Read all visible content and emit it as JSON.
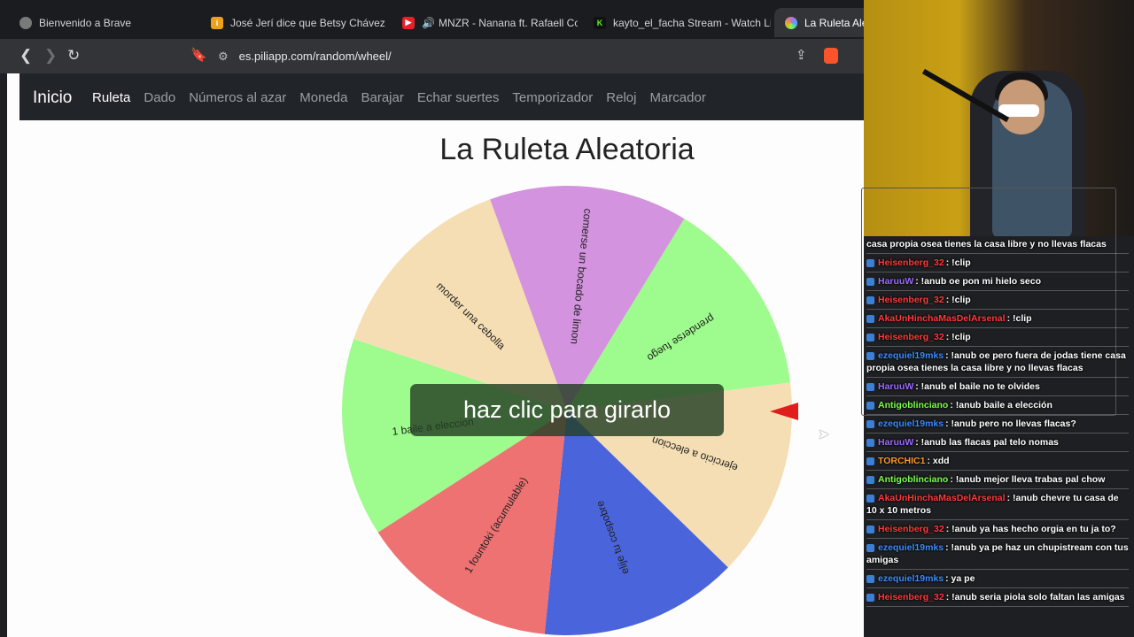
{
  "tabs": [
    {
      "title": "Bienvenido a Brave",
      "icon": "brave-globe-icon",
      "color": "#7a7a7a"
    },
    {
      "title": "José Jerí dice que Betsy Chávez s",
      "icon": "news-icon",
      "color": "#f0a020"
    },
    {
      "title": "MNZR - Nanana ft. Rafaell Co",
      "icon": "youtube-icon",
      "color": "#e8202a"
    },
    {
      "title": "kayto_el_facha Stream - Watch Liv",
      "icon": "kick-icon",
      "color": "#53fc18"
    },
    {
      "title": "La Ruleta Alea",
      "icon": "piliapp-icon",
      "color": "#c46cd6"
    }
  ],
  "address": {
    "url": "es.piliapp.com/random/wheel/"
  },
  "nav": {
    "brand": "Inicio",
    "links": [
      "Ruleta",
      "Dado",
      "Números al azar",
      "Moneda",
      "Barajar",
      "Echar suertes",
      "Temporizador",
      "Reloj",
      "Marcador"
    ],
    "active": "Ruleta"
  },
  "page": {
    "title": "La Ruleta Aleatoria",
    "spin_prompt": "haz clic para girarlo"
  },
  "wheel": {
    "segments": [
      {
        "label": "comerse un bocado de limon",
        "color": "#d493de"
      },
      {
        "label": "prenderse fuego",
        "color": "#9efb8d"
      },
      {
        "label": "ejercicio a eleccion",
        "color": "#f5deb3"
      },
      {
        "label": "elije tu cospobre",
        "color": "#4a64dc"
      },
      {
        "label": "1 fountoki (acumulable)",
        "color": "#ee7272"
      },
      {
        "label": "1 baile a eleccion",
        "color": "#9efb8d"
      },
      {
        "label": "morder una cebolla",
        "color": "#f5deb3"
      }
    ],
    "pointer_color": "#e01c1c"
  },
  "chat": {
    "messages": [
      {
        "user": "",
        "text": "casa propia osea tienes la casa libre y no llevas flacas",
        "color": "#ffffff"
      },
      {
        "user": "Heisenberg_32",
        "text": ": !clip",
        "color": "#ff3b3b"
      },
      {
        "user": "HaruuW",
        "text": ": !anub oe pon mi hielo seco",
        "color": "#9b6bff"
      },
      {
        "user": "Heisenberg_32",
        "text": ": !clip",
        "color": "#ff3b3b"
      },
      {
        "user": "AkaUnHinchaMasDelArsenal",
        "text": ": !clip",
        "color": "#ff3b3b"
      },
      {
        "user": "Heisenberg_32",
        "text": ": !clip",
        "color": "#ff3b3b"
      },
      {
        "user": "ezequiel19mks",
        "text": ": !anub oe pero fuera de jodas tiene casa propia osea tienes la casa libre y no llevas flacas",
        "color": "#3b8cff"
      },
      {
        "user": "HaruuW",
        "text": ": !anub el baile no te olvides",
        "color": "#9b6bff"
      },
      {
        "user": "Antigoblinciano",
        "text": ": !anub baile a elección",
        "color": "#7cff4a"
      },
      {
        "user": "ezequiel19mks",
        "text": ": !anub pero no llevas flacas?",
        "color": "#3b8cff"
      },
      {
        "user": "HaruuW",
        "text": ": !anub las flacas pal telo nomas",
        "color": "#9b6bff"
      },
      {
        "user": "TORCHIC1",
        "text": ": xdd",
        "color": "#ff9a2a"
      },
      {
        "user": "Antigoblinciano",
        "text": ": !anub mejor lleva trabas pal chow",
        "color": "#7cff4a"
      },
      {
        "user": "AkaUnHinchaMasDelArsenal",
        "text": ": !anub chevre tu casa de 10 x 10 metros",
        "color": "#ff3b3b"
      },
      {
        "user": "Heisenberg_32",
        "text": ": !anub ya has hecho orgia en tu ja to?",
        "color": "#ff3b3b"
      },
      {
        "user": "ezequiel19mks",
        "text": ": !anub ya pe haz un chupistream con tus amigas",
        "color": "#3b8cff"
      },
      {
        "user": "ezequiel19mks",
        "text": ": ya pe",
        "color": "#3b8cff"
      },
      {
        "user": "Heisenberg_32",
        "text": ": !anub seria piola solo faltan las amigas",
        "color": "#ff3b3b"
      }
    ]
  }
}
